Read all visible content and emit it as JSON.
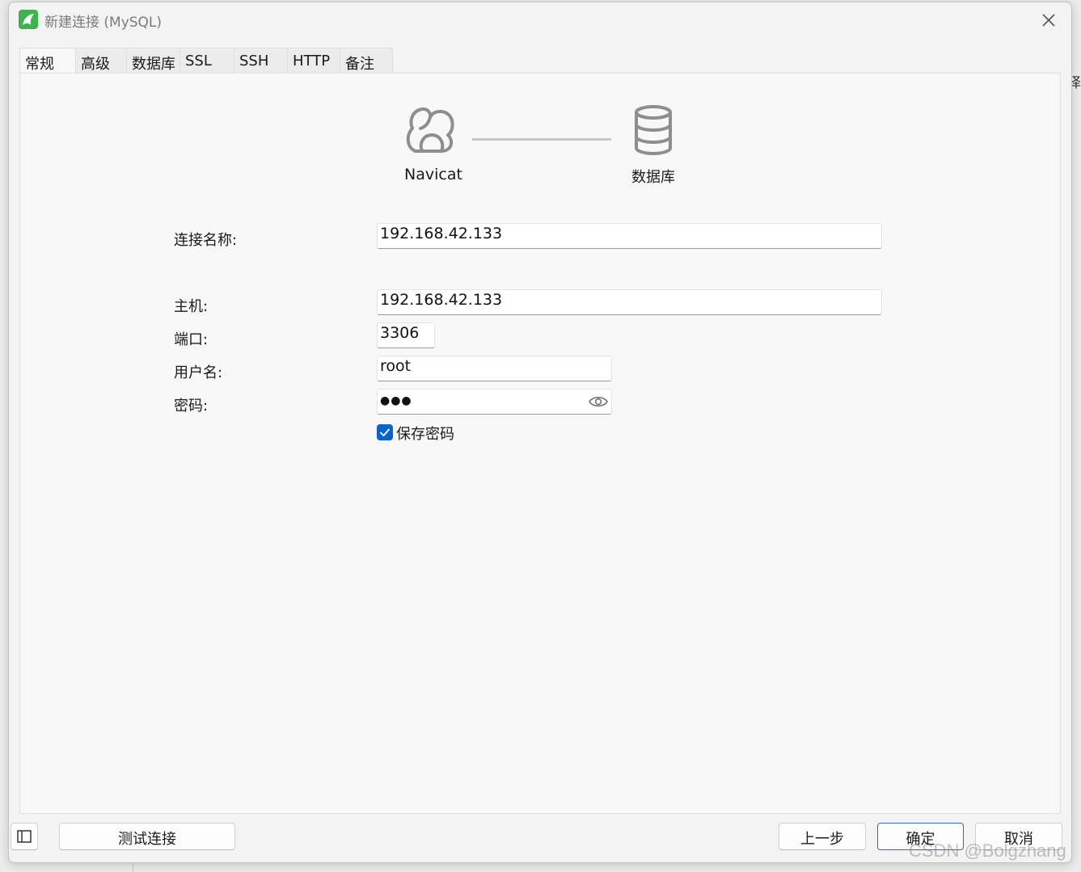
{
  "window": {
    "title": "新建连接 (MySQL)"
  },
  "tabs": [
    {
      "label": "常规",
      "active": true
    },
    {
      "label": "高级"
    },
    {
      "label": "数据库"
    },
    {
      "label": "SSL"
    },
    {
      "label": "SSH"
    },
    {
      "label": "HTTP"
    },
    {
      "label": "备注"
    }
  ],
  "diagram": {
    "left_label": "Navicat",
    "right_label": "数据库"
  },
  "form": {
    "connection_name": {
      "label": "连接名称:",
      "value": "192.168.42.133"
    },
    "host": {
      "label": "主机:",
      "value": "192.168.42.133"
    },
    "port": {
      "label": "端口:",
      "value": "3306"
    },
    "username": {
      "label": "用户名:",
      "value": "root"
    },
    "password": {
      "label": "密码:",
      "masked": "●●●"
    },
    "save_password": {
      "label": "保存密码",
      "checked": true
    }
  },
  "buttons": {
    "test_connection": "测试连接",
    "back": "上一步",
    "ok": "确定",
    "cancel": "取消"
  },
  "background": {
    "edge_glyph": "译"
  },
  "watermark": "CSDN @Bolgzhang",
  "colors": {
    "accent": "#0a63c9",
    "app_icon": "#3fb34f"
  }
}
